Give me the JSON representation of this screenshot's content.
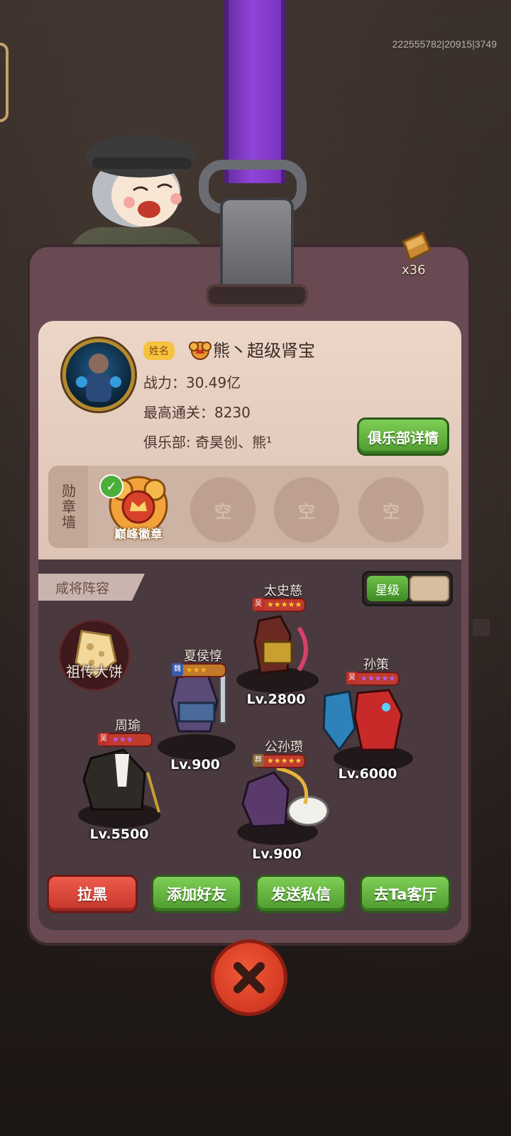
{
  "build_id": "222555782|20915|3749",
  "currency": {
    "icon": "gold-bar-icon",
    "count": "x36"
  },
  "player": {
    "name_tag": "姓名",
    "name": "熊丶超级肾宝",
    "power_label": "战力：",
    "power_value": "30.49亿",
    "max_stage_label": "最高通关：",
    "max_stage_value": "8230",
    "club_label": "俱乐部: ",
    "club_value": "奇昊创、熊¹",
    "club_details_button": "俱乐部详情"
  },
  "medal_wall": {
    "label": "勋章墙",
    "slots": [
      {
        "label": "巅峰徽章",
        "filled": true
      },
      {
        "label": "空",
        "filled": false
      },
      {
        "label": "空",
        "filled": false
      },
      {
        "label": "空",
        "filled": false
      }
    ]
  },
  "lineup": {
    "tab_label": "咸将阵容",
    "toggle_label": "星级",
    "relic_label": "祖传大饼",
    "heroes": [
      {
        "name": "太史慈",
        "level": "Lv.2800",
        "faction": "吴",
        "stars": 5,
        "star_color": "red"
      },
      {
        "name": "夏侯惇",
        "level": "Lv.900",
        "faction": "魏",
        "stars": 3,
        "star_color": "orange"
      },
      {
        "name": "孙策",
        "level": "Lv.6000",
        "faction": "吴",
        "stars": 5,
        "star_color": "purple"
      },
      {
        "name": "周瑜",
        "level": "Lv.5500",
        "faction": "吴",
        "stars": 3,
        "star_color": "purple"
      },
      {
        "name": "公孙瓒",
        "level": "Lv.900",
        "faction": "群",
        "stars": 5,
        "star_color": "red"
      }
    ]
  },
  "actions": {
    "block": "拉黑",
    "add_friend": "添加好友",
    "send_message": "发送私信",
    "visit_lounge": "去Ta客厅"
  },
  "colors": {
    "strap": "#9144d8",
    "green_button": "#4c9a2d",
    "red_button": "#c5352a",
    "card": "#6a4a52"
  }
}
